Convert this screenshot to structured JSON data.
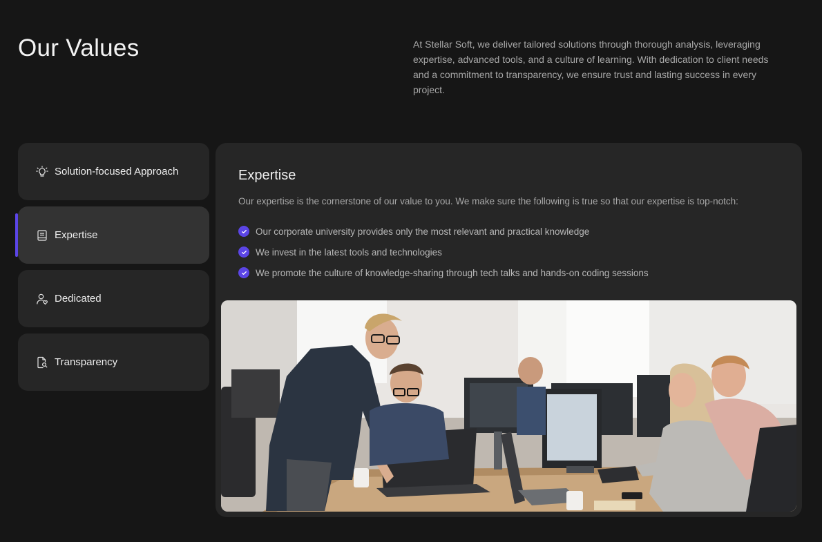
{
  "page": {
    "title": "Our Values",
    "intro": "At Stellar Soft, we deliver tailored solutions through thorough analysis, leveraging expertise, advanced tools, and a culture of learning. With dedication to client needs and a commitment to transparency, we ensure trust and lasting success in every project."
  },
  "tabs": [
    {
      "label": "Solution-focused Approach",
      "icon": "lightbulb-icon",
      "active": false
    },
    {
      "label": "Expertise",
      "icon": "book-icon",
      "active": true
    },
    {
      "label": "Dedicated",
      "icon": "user-heart-icon",
      "active": false
    },
    {
      "label": "Transparency",
      "icon": "document-search-icon",
      "active": false
    }
  ],
  "panel": {
    "title": "Expertise",
    "description": "Our expertise is the cornerstone of our value to you. We make sure the following is true so that our expertise is top-notch:",
    "points": [
      "Our corporate university provides only the most relevant and practical knowledge",
      "We invest in the latest tools and technologies",
      "We promote the culture of knowledge-sharing through tech talks and  hands-on coding sessions"
    ],
    "image": "office-team-photo"
  },
  "colors": {
    "background": "#161616",
    "card": "#262626",
    "card_active": "#333333",
    "accent": "#5b45e6",
    "text_muted": "#a8a8a8"
  }
}
